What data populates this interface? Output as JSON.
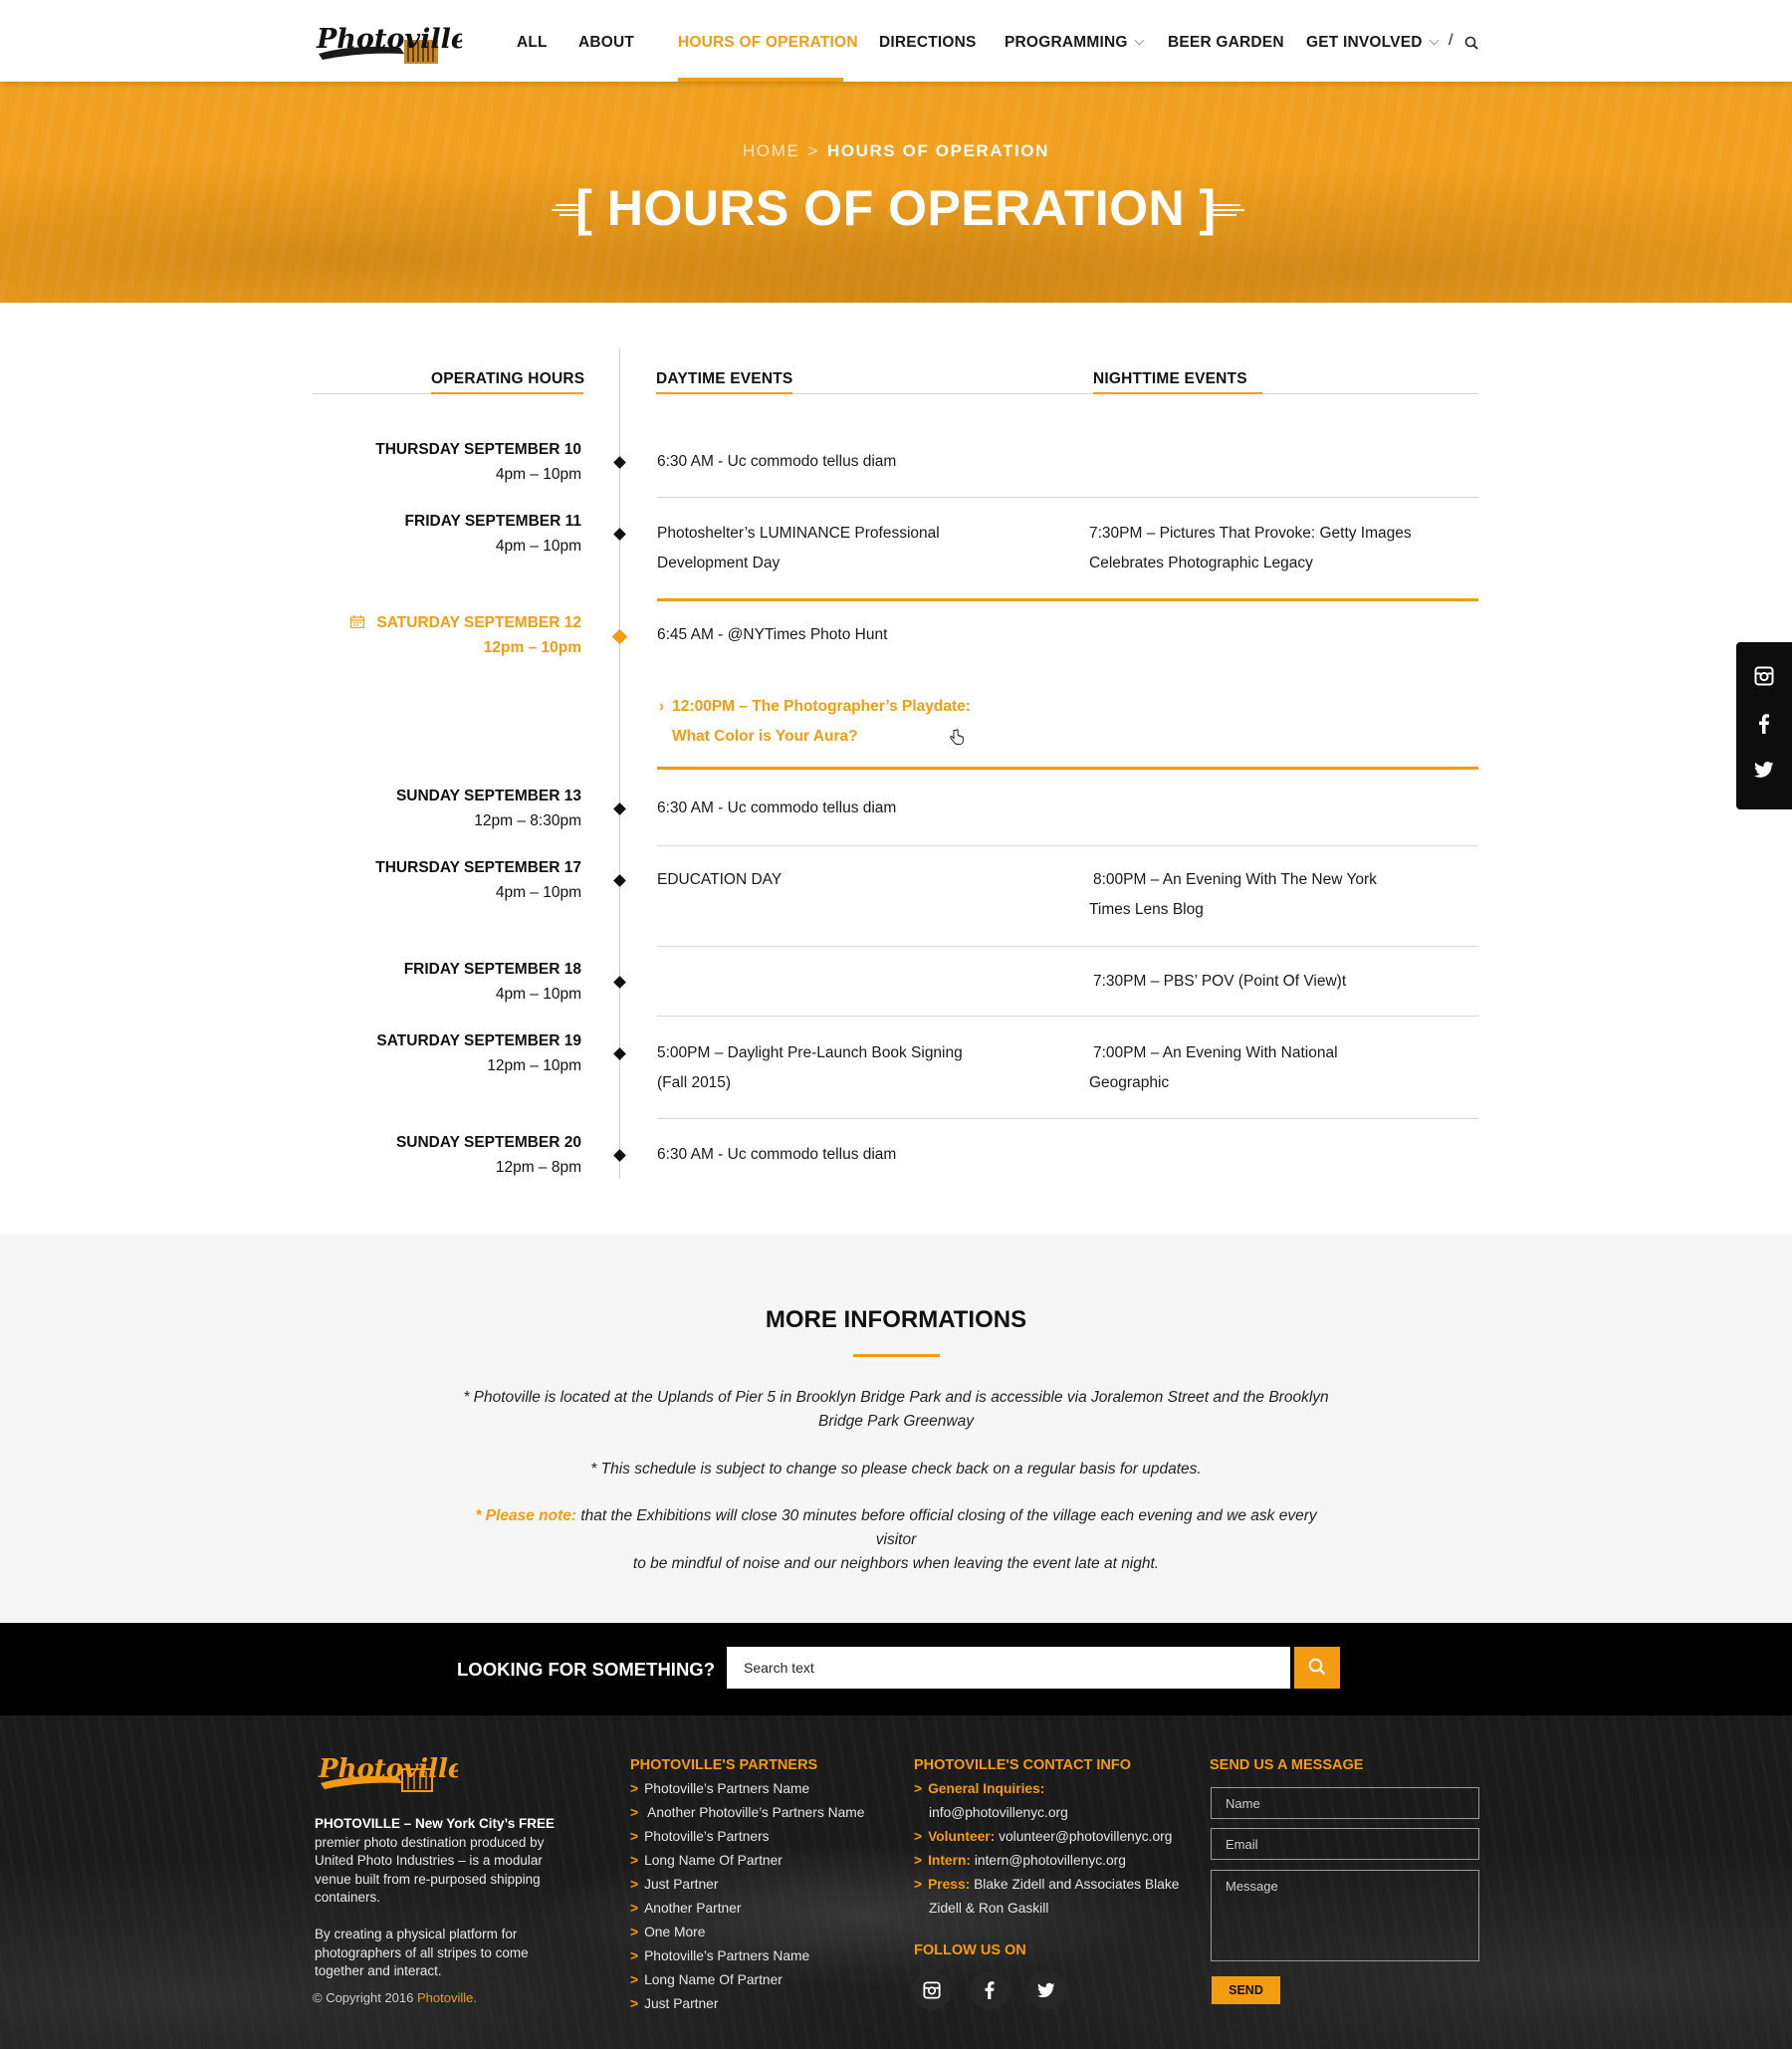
{
  "brand": {
    "name": "Photoville",
    "accent": "#f39c12"
  },
  "nav": {
    "items": [
      "ALL",
      "ABOUT",
      "HOURS OF OPERATION",
      "DIRECTIONS",
      "PROGRAMMING",
      "BEER GARDEN",
      "GET INVOLVED"
    ],
    "active": "HOURS OF OPERATION",
    "separator": "/"
  },
  "hero": {
    "breadcrumb_home": "HOME",
    "breadcrumb_sep": ">",
    "breadcrumb_current": "HOURS OF OPERATION",
    "title": "[ HOURS OF OPERATION ]"
  },
  "schedule": {
    "headers": {
      "hours": "OPERATING HOURS",
      "day": "DAYTIME EVENTS",
      "night": "NIGHTTIME EVENTS"
    },
    "days": [
      {
        "name": "THURSDAY SEPTEMBER 10",
        "hours": "4pm – 10pm"
      },
      {
        "name": "FRIDAY SEPTEMBER 11",
        "hours": "4pm – 10pm"
      },
      {
        "name": "SATURDAY SEPTEMBER 12",
        "hours": "12pm – 10pm",
        "active": true
      },
      {
        "name": "SUNDAY SEPTEMBER 13",
        "hours": "12pm – 8:30pm"
      },
      {
        "name": "THURSDAY SEPTEMBER 17",
        "hours": "4pm – 10pm"
      },
      {
        "name": "FRIDAY SEPTEMBER 18",
        "hours": "4pm – 10pm"
      },
      {
        "name": "SATURDAY SEPTEMBER 19",
        "hours": "12pm – 10pm"
      },
      {
        "name": "SUNDAY SEPTEMBER 20",
        "hours": "12pm – 8pm"
      }
    ],
    "events": {
      "e1_day": "6:30 AM - Uc commodo tellus diam",
      "e2_day_1": "Photoshelter’s LUMINANCE Professional",
      "e2_day_2": "Development Day",
      "e2_night_1": "7:30PM – Pictures That Provoke: Getty Images",
      "e2_night_2": "Celebrates Photographic Legacy",
      "e3_day": "6:45 AM - @NYTimes Photo Hunt",
      "e3_hl_1": "12:00PM – The Photographer’s Playdate:",
      "e3_hl_2": "What Color is Your Aura?",
      "e4_day": "6:30 AM - Uc commodo tellus diam",
      "e5_day": "EDUCATION DAY",
      "e5_night_1": "8:00PM – An Evening With The New York",
      "e5_night_2": "Times Lens Blog",
      "e6_night": "7:30PM – PBS’ POV (Point Of View)t",
      "e7_day_1": "5:00PM – Daylight Pre-Launch Book Signing",
      "e7_day_2": "(Fall 2015)",
      "e7_night_1": "7:00PM – An Evening With National",
      "e7_night_2": "Geographic",
      "e8_day": "6:30 AM - Uc commodo tellus diam"
    }
  },
  "side_social": [
    "instagram-icon",
    "facebook-icon",
    "twitter-icon"
  ],
  "more_info": {
    "title": "MORE INFORMATIONS",
    "p1_line1": "* Photoville is located at the Uplands of Pier 5 in Brooklyn Bridge Park and is accessible via Joralemon Street and the Brooklyn",
    "p1_line2": "Bridge Park Greenway",
    "p2": "* This schedule is subject to change so please check back on a regular basis for updates.",
    "p3_note": "* Please note:",
    "p3_line1": " that the Exhibitions will close 30 minutes before official closing of the village each evening and we ask every visitor",
    "p3_line2": "to be mindful of noise and our neighbors when leaving the event late at night."
  },
  "search": {
    "label": "LOOKING FOR SOMETHING?",
    "placeholder": "Search text"
  },
  "footer": {
    "about_bold": "PHOTOVILLE – New York City’s FREE",
    "about_rest": "premier photo destination produced by United Photo Industries – is a modular venue built from re-purposed shipping containers.",
    "about_p2": "By creating a physical platform for photographers of all stripes to come together and interact.",
    "copyright": "© Copyright 2016",
    "copyright_brand": "Photoville.",
    "partners_title": "PHOTOVILLE'S PARTNERS",
    "partners": [
      "Photoville’s Partners Name",
      " Another Photoville’s Partners Name",
      "Photoville’s Partners",
      "Long Name Of Partner",
      "Just Partner",
      "Another Partner",
      "One More",
      "Photoville’s Partners Name",
      "Long Name Of Partner",
      "Just Partner"
    ],
    "contact_title": "PHOTOVILLE'S CONTACT INFO",
    "contact": {
      "general_label": "General Inquiries:",
      "general_value": "info@photovillenyc.org",
      "volunteer_label": "Volunteer:",
      "volunteer_value": "volunteer@photovillenyc.org",
      "intern_label": "Intern:",
      "intern_value": "intern@photovillenyc.org",
      "press_label": "Press:",
      "press_value_1": "Blake Zidell and Associates Blake",
      "press_value_2": "Zidell & Ron Gaskill"
    },
    "follow_title": "FOLLOW US ON",
    "message_title": "SEND US A MESSAGE",
    "form": {
      "name": "Name",
      "email": "Email",
      "message": "Message",
      "send": "SEND"
    }
  }
}
